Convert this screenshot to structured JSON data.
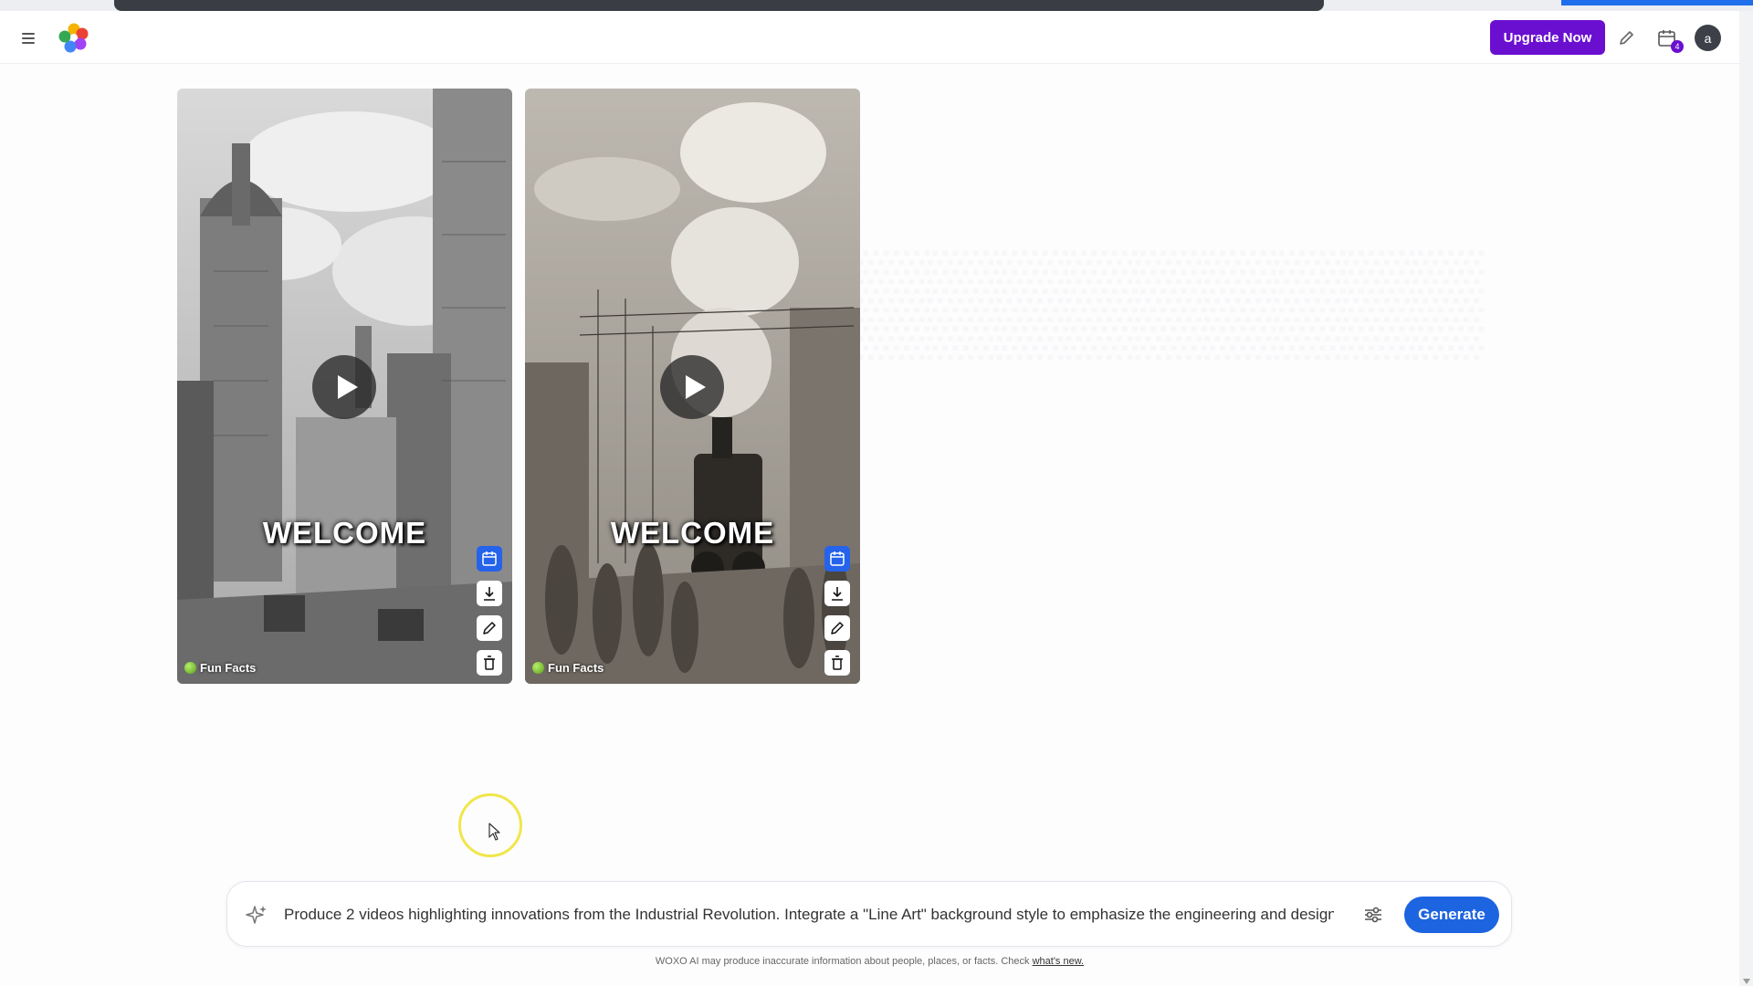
{
  "header": {
    "upgrade_label": "Upgrade Now",
    "notification_count": "4",
    "avatar_initial": "a"
  },
  "videos": [
    {
      "title_overlay": "WELCOME",
      "channel": "Fun Facts"
    },
    {
      "title_overlay": "WELCOME",
      "channel": "Fun Facts"
    }
  ],
  "prompt": {
    "value": "Produce 2 videos highlighting innovations from the Industrial Revolution. Integrate a \"Line Art\" background style to emphasize the engineering and design",
    "generate_label": "Generate"
  },
  "footer": {
    "disclaimer": "WOXO AI may produce inaccurate information about people, places, or facts. Check",
    "link": "what's new."
  },
  "colors": {
    "brand_purple": "#6a0fd0",
    "generate_blue": "#1d64e0",
    "schedule_blue": "#2563eb"
  },
  "icons": [
    "menu-icon",
    "logo-icon",
    "pencil-icon",
    "calendar-icon",
    "play-icon",
    "download-icon",
    "trash-icon",
    "sparkle-icon",
    "sliders-icon"
  ]
}
